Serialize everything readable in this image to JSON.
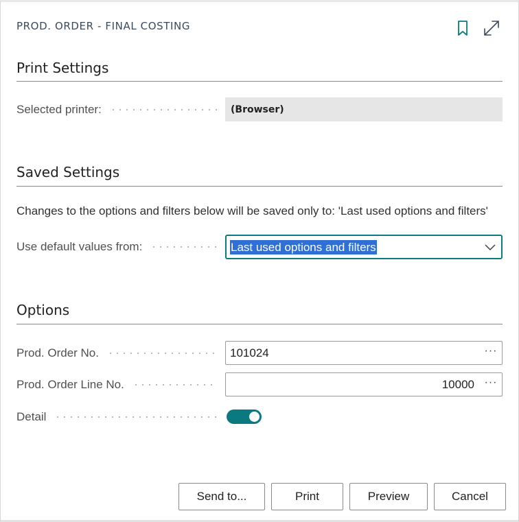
{
  "dialog": {
    "title": "PROD. ORDER - FINAL COSTING",
    "icons": {
      "bookmark": "bookmark-icon",
      "expand": "expand-icon"
    }
  },
  "print_settings": {
    "heading": "Print Settings",
    "selected_printer_label": "Selected printer:",
    "selected_printer_value": "(Browser)"
  },
  "saved_settings": {
    "heading": "Saved Settings",
    "info": "Changes to the options and filters below will be saved only to: 'Last used options and filters'",
    "default_values_label": "Use default values from:",
    "default_values_selected": "Last used options and filters"
  },
  "options": {
    "heading": "Options",
    "prod_order_no_label": "Prod. Order No.",
    "prod_order_no_value": "101024",
    "prod_order_line_no_label": "Prod. Order Line No.",
    "prod_order_line_no_value": "10000",
    "detail_label": "Detail",
    "detail_on": true,
    "ellipsis": "···"
  },
  "buttons": {
    "send_to": "Send to...",
    "print": "Print",
    "preview": "Preview",
    "cancel": "Cancel"
  },
  "colors": {
    "accent": "#0b7a80",
    "selection": "#2f6fd6"
  }
}
